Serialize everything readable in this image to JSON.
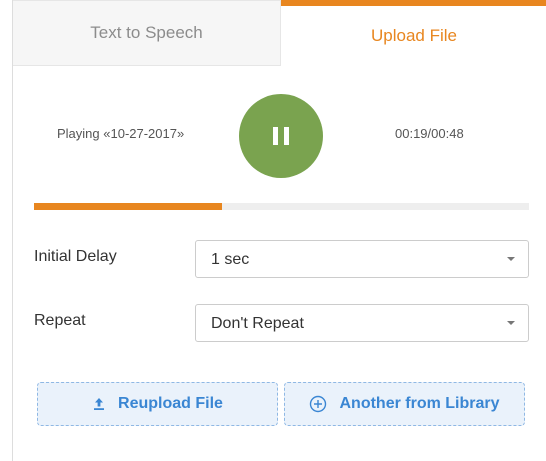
{
  "tabs": [
    {
      "label": "Text to Speech",
      "active": false
    },
    {
      "label": "Upload File",
      "active": true
    }
  ],
  "player": {
    "now_playing": "Playing «10-27-2017»",
    "state": "playing",
    "time": "00:19/00:48",
    "progress_fraction": 0.38
  },
  "form": {
    "initial_delay": {
      "label": "Initial Delay",
      "value": "1 sec"
    },
    "repeat": {
      "label": "Repeat",
      "value": "Don't Repeat"
    }
  },
  "actions": {
    "reupload_label": "Reupload File",
    "library_label": "Another from Library"
  },
  "icons": {
    "pause": "pause-icon",
    "upload": "upload-icon",
    "add": "add-circle-icon",
    "caret": "caret-down-icon"
  },
  "colors": {
    "accent": "#e8861f",
    "play_button": "#7aa34f",
    "button_text": "#3a86d3",
    "button_bg": "#eaf2fb",
    "button_border": "#8fb8e4"
  }
}
